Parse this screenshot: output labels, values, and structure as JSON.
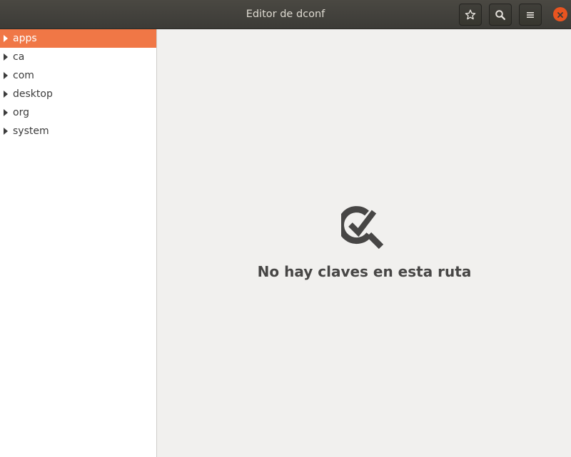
{
  "window": {
    "title": "Editor de dconf"
  },
  "header": {
    "buttons": [
      {
        "name": "bookmarks",
        "icon": "star-icon"
      },
      {
        "name": "search",
        "icon": "search-icon"
      },
      {
        "name": "menu",
        "icon": "hamburger-menu-icon"
      }
    ],
    "close_icon": "close-icon",
    "close_color": "#e95420"
  },
  "sidebar": {
    "items": [
      {
        "label": "apps",
        "selected": true
      },
      {
        "label": "ca",
        "selected": false
      },
      {
        "label": "com",
        "selected": false
      },
      {
        "label": "desktop",
        "selected": false
      },
      {
        "label": "org",
        "selected": false
      },
      {
        "label": "system",
        "selected": false
      }
    ],
    "selection_color": "#f07746"
  },
  "main": {
    "empty_icon": "key-search-icon",
    "empty_text": "No hay claves en esta ruta"
  }
}
